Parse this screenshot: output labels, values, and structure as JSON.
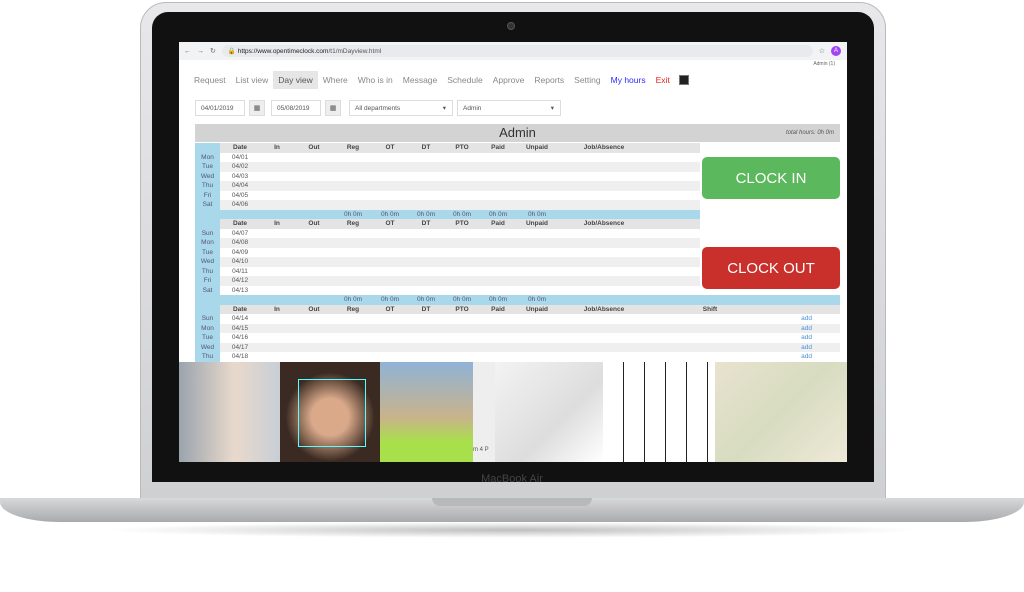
{
  "device": {
    "brand": "MacBook Air"
  },
  "browser": {
    "url_host": "https://www.opentimeclock.com",
    "url_path": "/t1/mDayview.html",
    "avatar": "A",
    "user_label": "Admin (1)"
  },
  "nav": [
    {
      "label": "Request"
    },
    {
      "label": "List view"
    },
    {
      "label": "Day view",
      "active": true
    },
    {
      "label": "Where"
    },
    {
      "label": "Who is in"
    },
    {
      "label": "Message"
    },
    {
      "label": "Schedule"
    },
    {
      "label": "Approve"
    },
    {
      "label": "Reports"
    },
    {
      "label": "Setting"
    },
    {
      "label": "My hours",
      "color": "#2b2bff"
    },
    {
      "label": "Exit",
      "color": "#e52222"
    }
  ],
  "filters": {
    "start_date": "04/01/2019",
    "end_date": "05/08/2019",
    "department": "All departments",
    "employee": "Admin"
  },
  "report": {
    "title": "Admin",
    "total_hours": "total hours: 0h 0m"
  },
  "columns": [
    "Date",
    "In",
    "Out",
    "Reg",
    "OT",
    "DT",
    "PTO",
    "Paid",
    "Unpaid",
    "Job/Absence",
    "Shift"
  ],
  "weeks": [
    {
      "days": [
        [
          "Mon",
          "04/01"
        ],
        [
          "Tue",
          "04/02"
        ],
        [
          "Wed",
          "04/03"
        ],
        [
          "Thu",
          "04/04"
        ],
        [
          "Fri",
          "04/05"
        ],
        [
          "Sat",
          "04/06"
        ]
      ],
      "totals": [
        "0h 0m",
        "0h 0m",
        "0h 0m",
        "0h 0m",
        "0h 0m",
        "0h 0m"
      ]
    },
    {
      "days": [
        [
          "Sun",
          "04/07"
        ],
        [
          "Mon",
          "04/08"
        ],
        [
          "Tue",
          "04/09"
        ],
        [
          "Wed",
          "04/10"
        ],
        [
          "Thu",
          "04/11"
        ],
        [
          "Fri",
          "04/12"
        ],
        [
          "Sat",
          "04/13"
        ]
      ],
      "totals": [
        "0h 0m",
        "0h 0m",
        "0h 0m",
        "0h 0m",
        "0h 0m",
        "0h 0m"
      ]
    },
    {
      "days": [
        [
          "Sun",
          "04/14"
        ],
        [
          "Mon",
          "04/15"
        ],
        [
          "Tue",
          "04/16"
        ],
        [
          "Wed",
          "04/17"
        ],
        [
          "Thu",
          "04/18"
        ]
      ],
      "add_label": "add"
    }
  ],
  "buttons": {
    "clock_in": "CLOCK IN",
    "clock_out": "CLOCK OUT",
    "clock_in_color": "#5cb85c",
    "clock_out_color": "#c9302c"
  },
  "photos": [
    "webcam",
    "face-recognition",
    "construction-worker",
    "barcode-nfc-scanner",
    "schedule-calendar",
    "map"
  ],
  "partial_text": "m 4 P"
}
